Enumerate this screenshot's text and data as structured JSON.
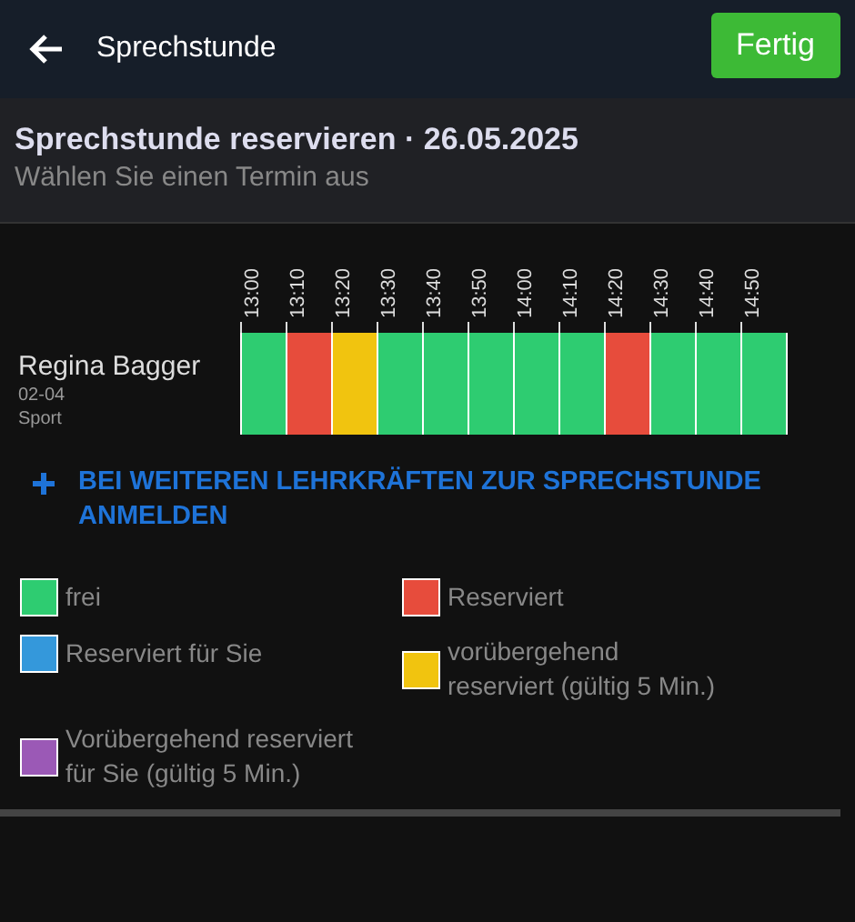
{
  "header": {
    "title": "Sprechstunde",
    "done_button": "Fertig"
  },
  "subheader": {
    "title": "Sprechstunde reservieren · 26.05.2025",
    "subtitle": "Wählen Sie einen Termin aus"
  },
  "teacher": {
    "name": "Regina Bagger",
    "room": "02-04",
    "subject": "Sport"
  },
  "slots": [
    {
      "time": "13:00",
      "color": "#2ecc71"
    },
    {
      "time": "13:10",
      "color": "#e74c3c"
    },
    {
      "time": "13:20",
      "color": "#f1c40f"
    },
    {
      "time": "13:30",
      "color": "#2ecc71"
    },
    {
      "time": "13:40",
      "color": "#2ecc71"
    },
    {
      "time": "13:50",
      "color": "#2ecc71"
    },
    {
      "time": "14:00",
      "color": "#2ecc71"
    },
    {
      "time": "14:10",
      "color": "#2ecc71"
    },
    {
      "time": "14:20",
      "color": "#e74c3c"
    },
    {
      "time": "14:30",
      "color": "#2ecc71"
    },
    {
      "time": "14:40",
      "color": "#2ecc71"
    },
    {
      "time": "14:50",
      "color": "#2ecc71"
    }
  ],
  "add_link": "BEI WEITEREN LEHRKRÄFTEN ZUR SPRECHSTUNDE ANMELDEN",
  "legend": [
    {
      "label": "frei",
      "color": "#2ecc71"
    },
    {
      "label": "Reserviert",
      "color": "#e74c3c"
    },
    {
      "label": "Reserviert für Sie",
      "color": "#3498db"
    },
    {
      "label": "vorübergehend reserviert (gültig 5 Min.)",
      "color": "#f1c40f"
    },
    {
      "label": "Vorübergehend reserviert für Sie (gültig 5 Min.)",
      "color": "#9b59b6"
    }
  ]
}
